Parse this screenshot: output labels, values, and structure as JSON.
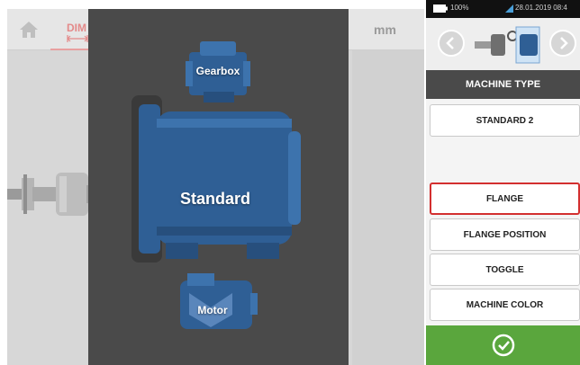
{
  "topbar": {
    "home_icon": "home-icon",
    "dim_tab_label": "DIM",
    "dim_icon": "dimension-arrows-icon",
    "unit": "mm"
  },
  "machines": {
    "gearbox_label": "Gearbox",
    "main_label": "Standard",
    "motor_label": "Motor"
  },
  "status_bar": {
    "battery": "100%",
    "datetime": "28.01.2019 08:4",
    "battery_icon": "battery-icon",
    "signal_icon": "signal-icon"
  },
  "panel": {
    "prev_icon": "chevron-left-circle-icon",
    "next_icon": "chevron-right-circle-icon",
    "section_title": "MACHINE TYPE",
    "selected_type": "STANDARD 2",
    "buttons": [
      "FLANGE",
      "FLANGE POSITION",
      "TOGGLE",
      "MACHINE COLOR"
    ],
    "active_button_index": 0,
    "confirm_icon": "check-circle-icon"
  },
  "colors": {
    "overlay": "#4a4a4a",
    "machine_blue": "#2f5f95",
    "accent_red": "#d32f2f",
    "confirm_green": "#5aa63d"
  }
}
